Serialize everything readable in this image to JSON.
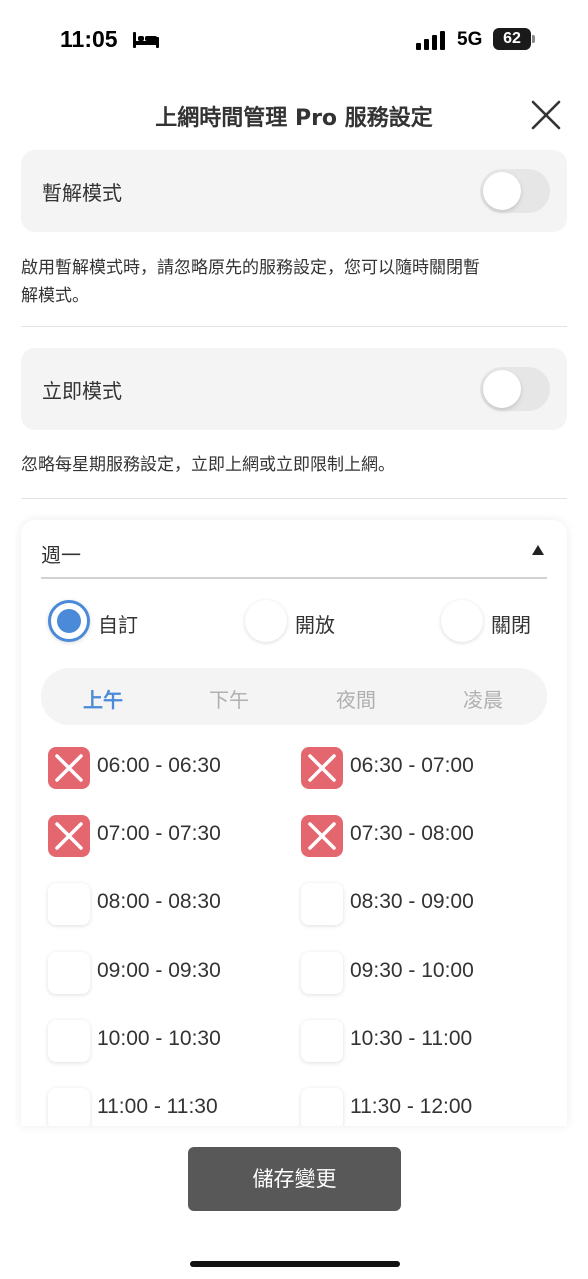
{
  "status_bar": {
    "time": "11:05",
    "network": "5G",
    "battery": "62"
  },
  "header": {
    "title": "上網時間管理 Pro  服務設定"
  },
  "pause_mode": {
    "label": "暫解模式",
    "enabled": false,
    "description": "啟用暫解模式時，請忽略原先的服務設定，您可以隨時關閉暫解模式。"
  },
  "instant_mode": {
    "label": "立即模式",
    "enabled": false,
    "description": "忽略每星期服務設定，立即上網或立即限制上網。"
  },
  "day_panel": {
    "day": "週一",
    "options": [
      {
        "label": "自訂",
        "selected": true
      },
      {
        "label": "開放",
        "selected": false
      },
      {
        "label": "關閉",
        "selected": false
      }
    ],
    "tabs": [
      {
        "label": "上午",
        "active": true
      },
      {
        "label": "下午",
        "active": false
      },
      {
        "label": "夜間",
        "active": false
      },
      {
        "label": "凌晨",
        "active": false
      }
    ],
    "slots": [
      {
        "label": "06:00 - 06:30",
        "blocked": true
      },
      {
        "label": "06:30 - 07:00",
        "blocked": true
      },
      {
        "label": "07:00 - 07:30",
        "blocked": true
      },
      {
        "label": "07:30 - 08:00",
        "blocked": true
      },
      {
        "label": "08:00 - 08:30",
        "blocked": false
      },
      {
        "label": "08:30 - 09:00",
        "blocked": false
      },
      {
        "label": "09:00 - 09:30",
        "blocked": false
      },
      {
        "label": "09:30 - 10:00",
        "blocked": false
      },
      {
        "label": "10:00 - 10:30",
        "blocked": false
      },
      {
        "label": "10:30 - 11:00",
        "blocked": false
      },
      {
        "label": "11:00 - 11:30",
        "blocked": false
      },
      {
        "label": "11:30 - 12:00",
        "blocked": false
      }
    ]
  },
  "save_label": "儲存變更",
  "colors": {
    "accent": "#4a8ad8",
    "blocked": "#e4666f",
    "button": "#585858"
  },
  "icons": [
    "bed-icon",
    "signal-icon",
    "battery-icon",
    "close-icon",
    "caret-up-icon",
    "x-mark-icon"
  ]
}
